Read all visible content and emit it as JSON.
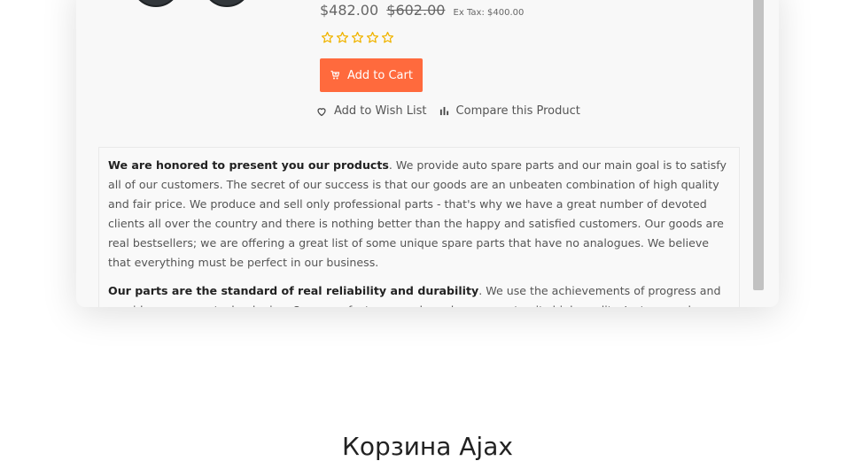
{
  "product": {
    "price_new": "$482.00",
    "price_old": "$602.00",
    "price_tax": "Ex Tax: $400.00",
    "rating": 0,
    "rating_max": 5,
    "add_to_cart_label": "Add to Cart",
    "wishlist_label": "Add to Wish List",
    "compare_label": "Compare this Product",
    "image_icon": "wheels-image",
    "colors": {
      "accent": "#ff6a3d",
      "star": "#f0b400"
    }
  },
  "description": {
    "p1_bold": "We are honored to present you our products",
    "p1_text": ". We provide auto spare parts and our main goal is to satisfy all of our customers. The secret of our success is that our goods are an unbeaten combination of high quality and fair price. We produce and sell only professional parts - that's why we have a great number of devoted clients all over the country and there is nothing better than the happy and satisfied customers. Our goods are real bestsellers; we are offering a great list of some unique spare parts that have no analogues. We believe that everything must be perfect in our business.",
    "p2_bold": "Our parts are the standard of real reliability and durability",
    "p2_text": ". We use the achievements of progress and provide some new technologies. Our manufacturers and vendors guarantee its high quality. Just remember that we estimate our"
  },
  "section": {
    "title": "Корзина Ajax"
  }
}
